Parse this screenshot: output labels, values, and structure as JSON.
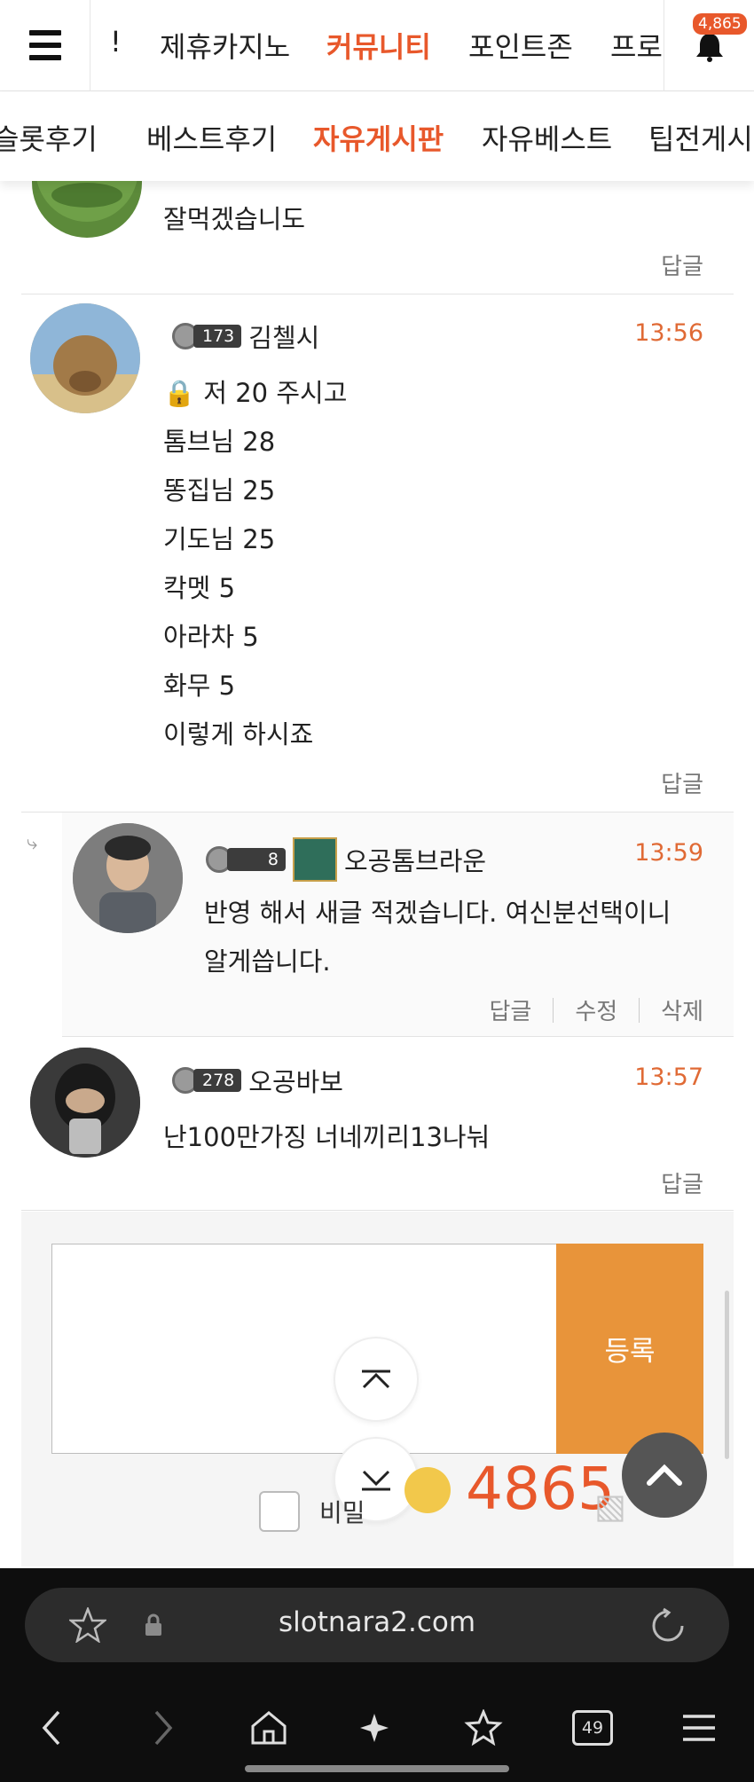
{
  "top_nav": {
    "tabs": [
      "!",
      "제휴카지노",
      "커뮤니티",
      "포인트존",
      "프로"
    ],
    "active": "커뮤니티",
    "notification_count": "4,865"
  },
  "sub_nav": {
    "tabs": [
      "슬롯후기",
      "베스트후기",
      "자유게시판",
      "자유베스트",
      "팁전게시"
    ],
    "active": "자유게시판"
  },
  "comments": [
    {
      "body_lines": [
        "잘먹겠습니도"
      ],
      "actions": [
        "답글"
      ]
    },
    {
      "level": "173",
      "nick": "김첼시",
      "time": "13:56",
      "body_lines": [
        "🔒 저 20 주시고",
        "톰브님 28",
        "똥집님 25",
        "기도님 25",
        "칵멧 5",
        "아라차 5",
        "화무 5",
        "이렇게 하시죠"
      ],
      "actions": [
        "답글"
      ]
    },
    {
      "level": "8",
      "nick": "오공톰브라운",
      "time": "13:59",
      "body_lines": [
        "반영 해서 새글 적겠습니다. 여신분선택이니",
        "알게씁니다."
      ],
      "actions": [
        "답글",
        "수정",
        "삭제"
      ]
    },
    {
      "level": "278",
      "nick": "오공바보",
      "time": "13:57",
      "body_lines": [
        "난100만가징 너네끼리13나눠"
      ],
      "actions": [
        "답글"
      ]
    }
  ],
  "write": {
    "submit_label": "등록",
    "secret_label": "비밀",
    "points": "4865"
  },
  "browser": {
    "url": "slotnara2.com",
    "tab_count": "49"
  },
  "colors": {
    "accent": "#e8582b",
    "submit": "#e8943a",
    "time": "#e06a35"
  }
}
